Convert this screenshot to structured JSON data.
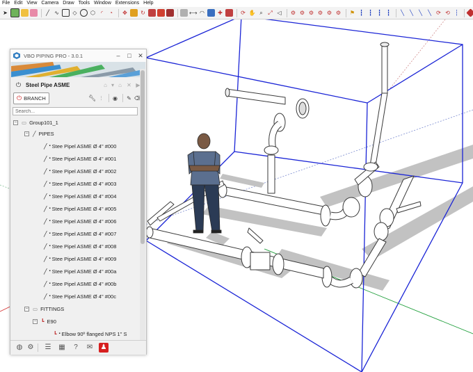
{
  "menubar": [
    "File",
    "Edit",
    "View",
    "Camera",
    "Draw",
    "Tools",
    "Window",
    "Extensions",
    "Help"
  ],
  "panel": {
    "window_title": "VBO PIPING PRO - 3.0.1",
    "header_title": "Steel Pipe ASME",
    "branch_label": "BRANCH",
    "search_placeholder": "Search...",
    "tree": {
      "group": "Group101_1",
      "pipes_label": "PIPES",
      "pipes": [
        "Stee Pipel ASME Ø 4\" #000",
        "Stee Pipel ASME Ø 4\" #001",
        "Stee Pipel ASME Ø 4\" #002",
        "Stee Pipel ASME Ø 4\" #003",
        "Stee Pipel ASME Ø 4\" #004",
        "Stee Pipel ASME Ø 4\" #005",
        "Stee Pipel ASME Ø 4\" #006",
        "Stee Pipel ASME Ø 4\" #007",
        "Stee Pipel ASME Ø 4\" #008",
        "Stee Pipel ASME Ø 4\" #009",
        "Stee Pipel ASME Ø 4\" #00a",
        "Stee Pipel ASME Ø 4\" #00b",
        "Stee Pipel ASME Ø 4\" #00c"
      ],
      "fittings_label": "FITTINGS",
      "e90_label": "E90",
      "elbow_item": "Elbow 90º flanged NPS 1\" S"
    }
  },
  "colors": {
    "bbox": "#1a24d6",
    "pipe_stroke": "#3a3a3a",
    "shadow": "#bdbdbd",
    "axis_green": "#1e9e3a",
    "axis_red": "#d83a3a",
    "person_shirt": "#5b6f8f",
    "person_pants": "#2b3b55"
  }
}
